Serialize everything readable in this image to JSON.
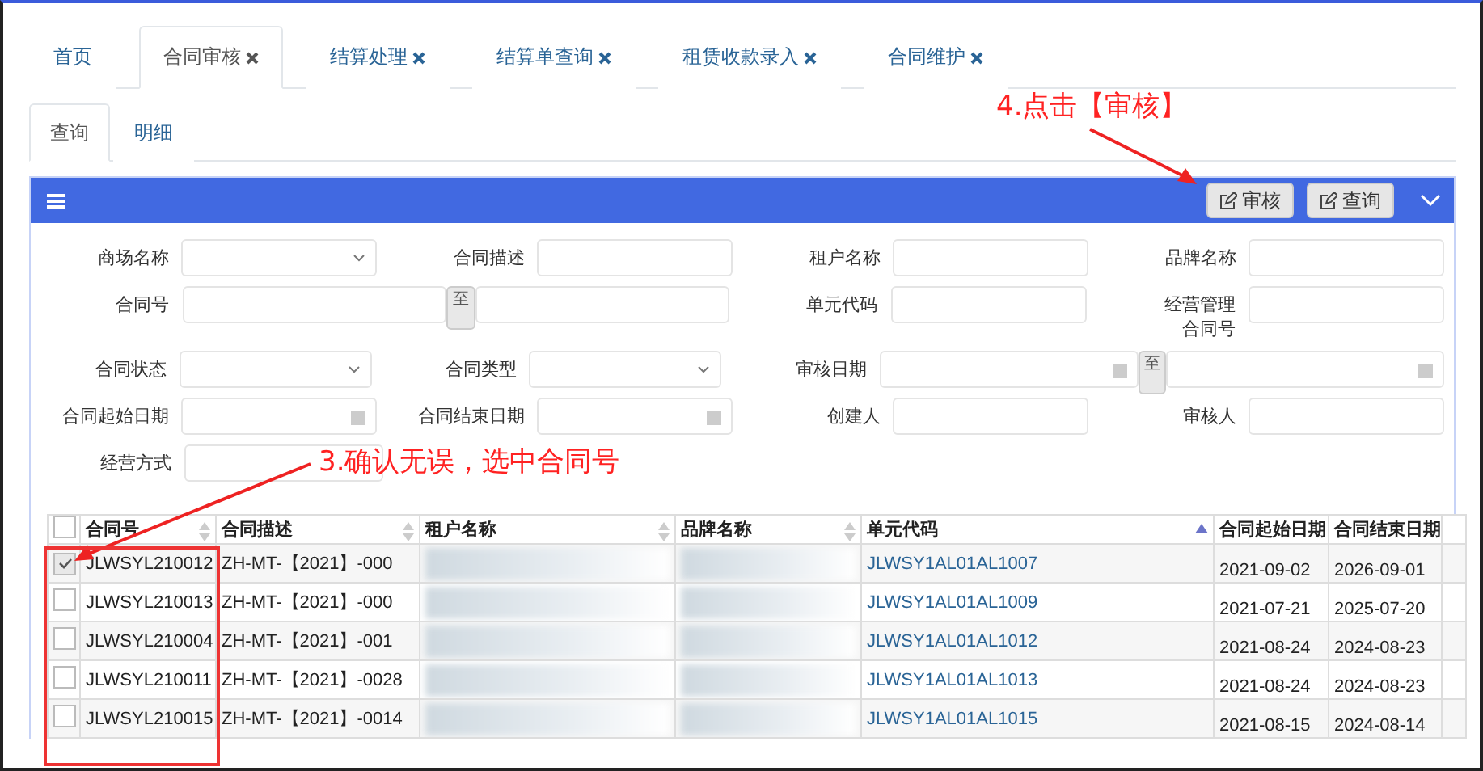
{
  "tabs": [
    {
      "label": "首页",
      "closable": false,
      "selected": false
    },
    {
      "label": "合同审核",
      "closable": true,
      "selected": true
    },
    {
      "label": "结算处理",
      "closable": true,
      "selected": false
    },
    {
      "label": "结算单查询",
      "closable": true,
      "selected": false
    },
    {
      "label": "租赁收款录入",
      "closable": true,
      "selected": false
    },
    {
      "label": "合同维护",
      "closable": true,
      "selected": false
    }
  ],
  "sub_tabs": [
    {
      "label": "查询",
      "selected": true
    },
    {
      "label": "明细",
      "selected": false
    }
  ],
  "toolbar": {
    "buttons": [
      "审核",
      "查询"
    ]
  },
  "form_rows": [
    [
      {
        "label": "商场名称",
        "kind": "select"
      },
      {
        "label": "合同描述",
        "kind": "text"
      },
      {
        "label": "租户名称",
        "kind": "text"
      },
      {
        "label": "品牌名称",
        "kind": "text"
      }
    ],
    [
      {
        "label": "合同号",
        "kind": "range",
        "sep": "至"
      },
      {
        "label": "单元代码",
        "kind": "text"
      },
      {
        "label": "经营管理合同号",
        "kind": "text"
      }
    ],
    [
      {
        "label": "合同状态",
        "kind": "select"
      },
      {
        "label": "合同类型",
        "kind": "select"
      },
      {
        "label": "审核日期",
        "kind": "date_range",
        "sep": "至"
      }
    ],
    [
      {
        "label": "合同起始日期",
        "kind": "date"
      },
      {
        "label": "合同结束日期",
        "kind": "date"
      },
      {
        "label": "创建人",
        "kind": "text"
      },
      {
        "label": "审核人",
        "kind": "text"
      }
    ],
    [
      {
        "label": "经营方式",
        "kind": "text"
      }
    ]
  ],
  "table": {
    "select_all_checked": false,
    "columns": [
      {
        "label": "合同号",
        "sortable": true,
        "sorted": false
      },
      {
        "label": "合同描述",
        "sortable": true,
        "sorted": false
      },
      {
        "label": "租户名称",
        "sortable": true,
        "sorted": false
      },
      {
        "label": "品牌名称",
        "sortable": true,
        "sorted": false
      },
      {
        "label": "单元代码",
        "sortable": true,
        "sorted": true
      },
      {
        "label": "合同起始日期",
        "sortable": false,
        "sorted": false
      },
      {
        "label": "合同结束日期",
        "sortable": false,
        "sorted": false
      }
    ],
    "rows": [
      {
        "checked": true,
        "contract_no": "JLWSYL210012",
        "description": "ZH-MT-【2021】-000",
        "unit_code": "JLWSY1AL01AL1007",
        "start": "2021-09-02",
        "end": "2026-09-01"
      },
      {
        "checked": false,
        "contract_no": "JLWSYL210013",
        "description": "ZH-MT-【2021】-000",
        "unit_code": "JLWSY1AL01AL1009",
        "start": "2021-07-21",
        "end": "2025-07-20"
      },
      {
        "checked": false,
        "contract_no": "JLWSYL210004",
        "description": "ZH-MT-【2021】-001",
        "unit_code": "JLWSY1AL01AL1012",
        "start": "2021-08-24",
        "end": "2024-08-23"
      },
      {
        "checked": false,
        "contract_no": "JLWSYL210011",
        "description": "ZH-MT-【2021】-0028",
        "unit_code": "JLWSY1AL01AL1013",
        "start": "2021-08-24",
        "end": "2024-08-23"
      },
      {
        "checked": false,
        "contract_no": "JLWSYL210015",
        "description": "ZH-MT-【2021】-0014",
        "unit_code": "JLWSY1AL01AL1015",
        "start": "2021-08-15",
        "end": "2024-08-14"
      }
    ]
  },
  "annotations": [
    "4.点击【审核】",
    "3.确认无误，选中合同号"
  ]
}
